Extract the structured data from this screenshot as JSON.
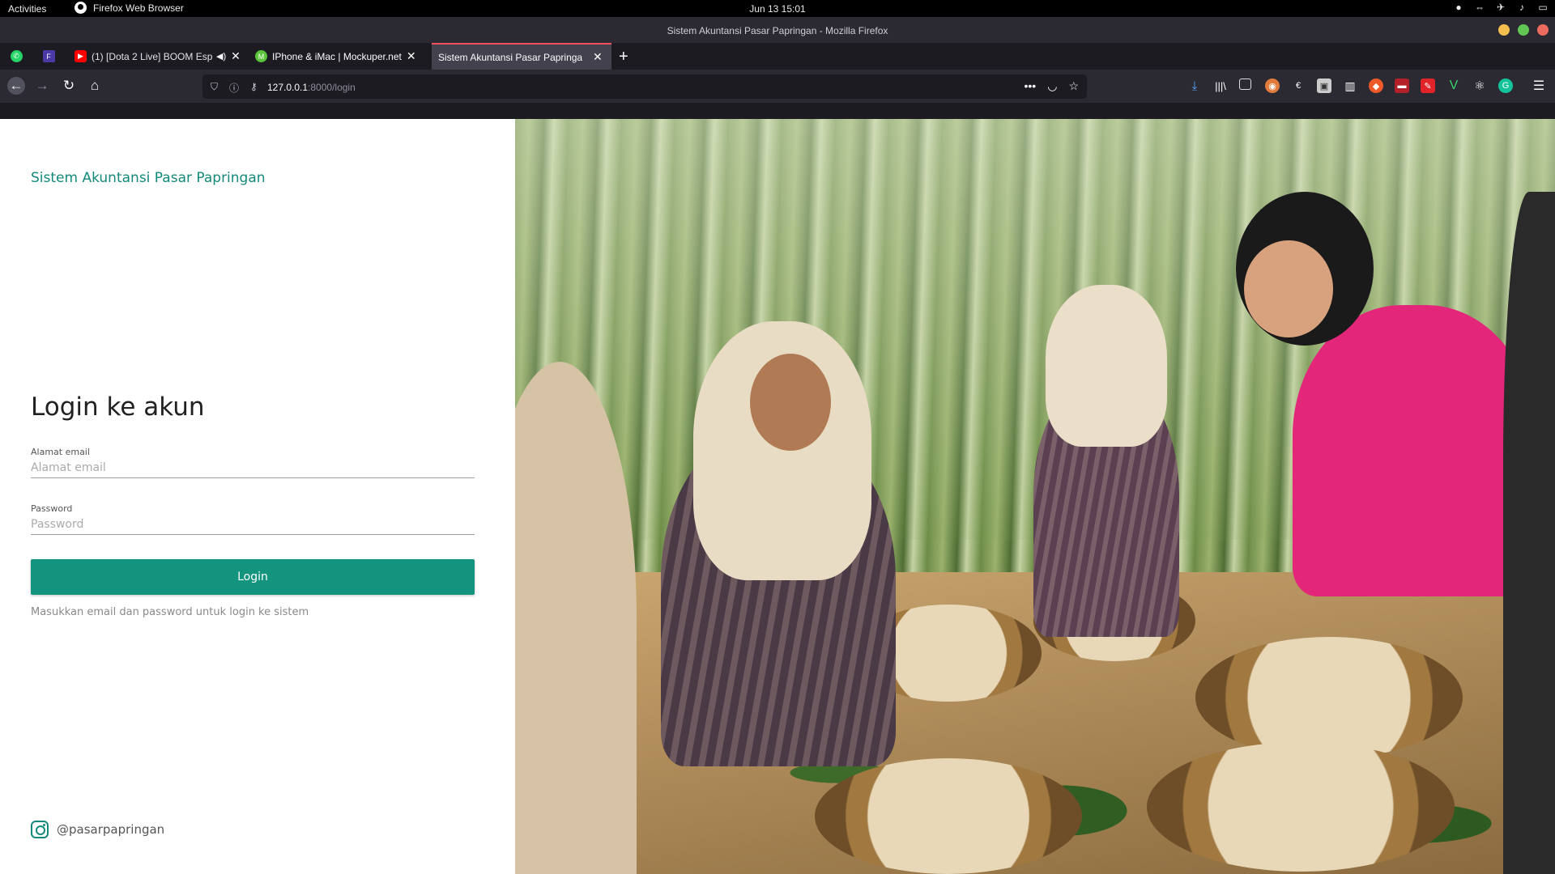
{
  "os": {
    "activities": "Activities",
    "app_name": "Firefox Web Browser",
    "clock": "Jun 13  15:01"
  },
  "window": {
    "title": "Sistem Akuntansi Pasar Papringan - Mozilla Firefox"
  },
  "tabs": [
    {
      "label": "(1) [Dota 2 Live] BOOM Esp",
      "favicon": "youtube-icon",
      "muted_icon": "speaker-icon"
    },
    {
      "label": "IPhone & iMac | Mockuper.net",
      "favicon": "mockuper-icon"
    },
    {
      "label": "Sistem Akuntansi Pasar Papringa",
      "favicon": "none",
      "active": true
    }
  ],
  "navbar": {
    "url_host": "127.0.0.1",
    "url_path": ":8000/login"
  },
  "page": {
    "brand": "Sistem Akuntansi Pasar Papringan",
    "heading": "Login ke akun",
    "email": {
      "label": "Alamat email",
      "placeholder": "Alamat email",
      "value": ""
    },
    "password": {
      "label": "Password",
      "placeholder": "Password",
      "value": ""
    },
    "login_button": "Login",
    "hint": "Masukkan email dan password untuk login ke sistem",
    "instagram": "@pasarpapringan"
  },
  "colors": {
    "accent": "#13947f",
    "brand_text": "#13897a",
    "active_tab_border": "#ff4f5e"
  }
}
